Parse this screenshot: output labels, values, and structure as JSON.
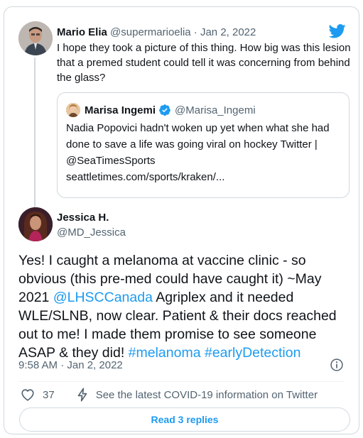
{
  "quoted_parent": {
    "author_name": "Mario Elia",
    "meta": "@supermarioelia · Jan 2, 2022",
    "text": "I hope they took a picture of this thing. How big was this lesion that a premed student could tell it was concerning from behind the glass?",
    "avatar_icon": "person-photo-avatar"
  },
  "quote": {
    "author_name": "Marisa Ingemi",
    "handle": "@Marisa_Ingemi",
    "verified_icon": "verified-badge-icon",
    "text": "Nadia Popovici hadn't woken up yet when what she had done to save a life was going viral on hockey Twitter | @SeaTimesSports",
    "link": "seattletimes.com/sports/kraken/..."
  },
  "tweet": {
    "author_name": "Jessica H.",
    "handle": "@MD_Jessica",
    "text_parts": {
      "p1": "Yes! I caught a melanoma at vaccine clinic - so obvious (this pre-med could have caught it) ~May 2021 ",
      "mention": "@LHSCCanada",
      "p2": " Agriplex and it needed WLE/SLNB, now clear. Patient & their docs reached out to me! I made them promise to see someone ASAP & they did! ",
      "hashtag1": "#melanoma",
      "sp": " ",
      "hashtag2": "#earlyDetection"
    },
    "timestamp": "9:58 AM · Jan 2, 2022",
    "likes": "37",
    "covid_link": "See the latest COVID-19 information on Twitter",
    "read_replies": "Read 3 replies"
  },
  "icons": [
    "twitter-bird-icon",
    "info-icon",
    "heart-icon",
    "bolt-icon",
    "verified-badge-icon"
  ],
  "colors": {
    "accent": "#1d9bf0",
    "text": "#0f1419",
    "muted": "#536471",
    "border": "#cfd9de"
  }
}
